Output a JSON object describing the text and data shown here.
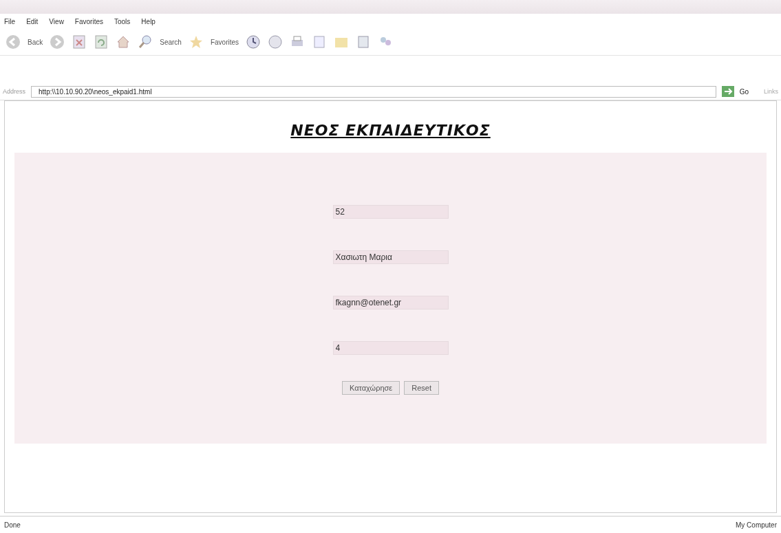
{
  "menu": [
    "File",
    "Edit",
    "View",
    "Favorites",
    "Tools",
    "Help"
  ],
  "toolbar": {
    "back": "Back",
    "search": "Search",
    "favorites": "Favorites"
  },
  "address": {
    "label": "Address",
    "url": "http:\\\\10.10.90.20\\neos_ekpaid1.html",
    "go": "Go",
    "links": "Links"
  },
  "page": {
    "heading": "ΝΕΟΣ ΕΚΠΑΙΔΕΥΤΙΚΟΣ",
    "fields": [
      {
        "value": "52"
      },
      {
        "value": "Χασιωτη Μαρια"
      },
      {
        "value": "fkagnn@otenet.gr"
      },
      {
        "value": "4"
      }
    ],
    "buttons": [
      "Καταχώρησε",
      "Reset"
    ]
  },
  "status_bar": {
    "left": "Done",
    "right": "My Computer"
  }
}
